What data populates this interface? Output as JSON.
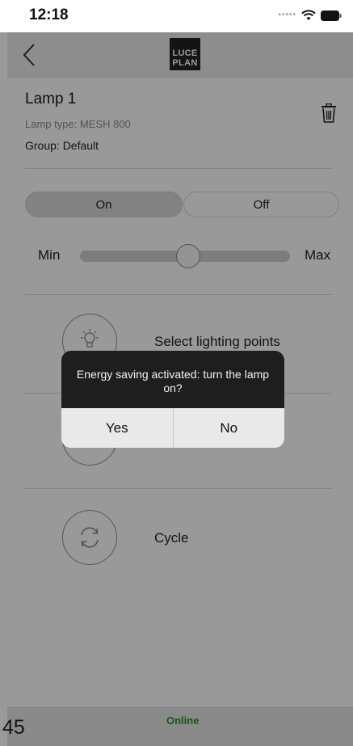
{
  "status_bar": {
    "time": "12:18",
    "icons": [
      "signal-dots",
      "wifi-icon",
      "battery-icon"
    ]
  },
  "nav": {
    "back_icon": "chevron-left-icon",
    "brand_line1": "LUCE",
    "brand_line2": "PLAN"
  },
  "lamp": {
    "name": "Lamp 1",
    "type_label": "Lamp type: MESH 800",
    "group_label": "Group: Default",
    "delete_icon": "trash-icon"
  },
  "power": {
    "on_label": "On",
    "off_label": "Off",
    "selected": "On"
  },
  "dimmer": {
    "min_label": "Min",
    "max_label": "Max",
    "level": 0.5
  },
  "features": [
    {
      "label": "Select lighting points",
      "icon": "lighting-points-icon"
    },
    {
      "label": "",
      "icon": "timer-icon"
    },
    {
      "label": "Cycle",
      "icon": "cycle-icon"
    }
  ],
  "footer": {
    "count": "45",
    "status": "Online",
    "status_color": "#2e8b2e"
  },
  "alert": {
    "message": "Energy saving activated: turn the lamp on?",
    "yes_label": "Yes",
    "no_label": "No"
  }
}
